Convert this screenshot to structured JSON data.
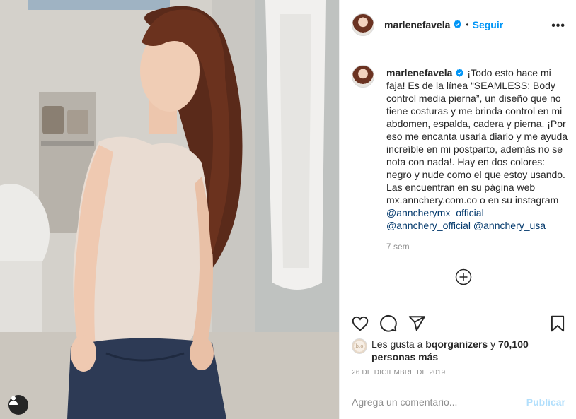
{
  "post": {
    "username": "marlenefavela",
    "follow_label": "Seguir",
    "separator": "•",
    "more_label": "•••"
  },
  "caption": {
    "username": "marlenefavela",
    "text_1": "¡Todo esto hace mi faja! Es de la línea “SEAMLESS: Body control media pierna”, un diseño que no tiene costuras y me brinda control en mi abdomen, espalda, cadera y pierna. ¡Por eso me encanta usarla diario y me ayuda increíble en mi postparto, además no se nota con nada!. Hay en dos colores: negro y nude como el que estoy usando. Las encuentran en su página web mx.annchery.com.co o en su instagram ",
    "mention_1": "@annchery​mx_official",
    "mention_2": "@annchery_official",
    "mention_3": "@annchery_usa",
    "time_ago": "7 sem"
  },
  "likes": {
    "prefix": "Les gusta a ",
    "user": "bqorganizers",
    "middle": " y ",
    "count": "70,100 personas más",
    "avatar_initials": "b.o"
  },
  "date": "26 DE DICIEMBRE DE 2019",
  "comment": {
    "placeholder": "Agrega un comentario...",
    "publish_label": "Publicar"
  },
  "colors": {
    "accent": "#0095f6",
    "mention": "#00376b",
    "muted": "#8e8e8e",
    "publish_disabled": "#b2dffc"
  },
  "icons": [
    "verified-badge-icon",
    "more-options-icon",
    "load-more-comments-icon",
    "heart-icon",
    "comment-icon",
    "share-icon",
    "bookmark-icon",
    "user-tag-icon"
  ]
}
